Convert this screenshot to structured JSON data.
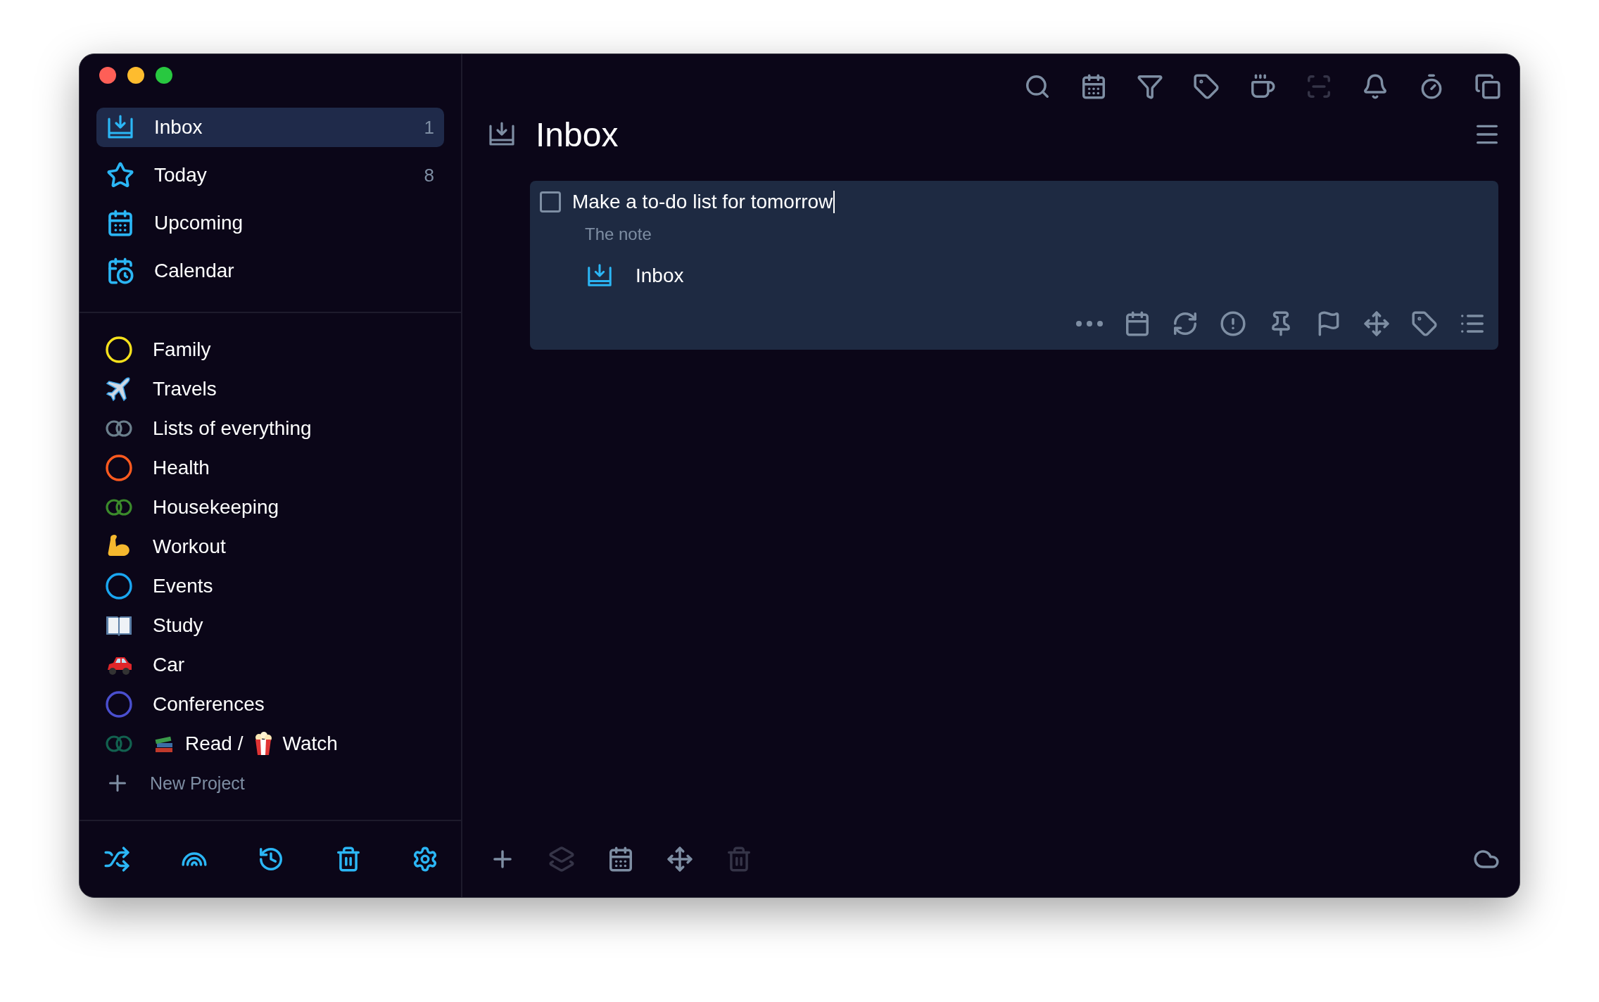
{
  "window": {
    "controls": [
      {
        "color": "#fe5f57"
      },
      {
        "color": "#febc2e"
      },
      {
        "color": "#28c840"
      }
    ]
  },
  "sidebar": {
    "nav": [
      {
        "kind": "inbox",
        "label": "Inbox",
        "count": "1",
        "selected": true
      },
      {
        "kind": "today",
        "label": "Today",
        "count": "8",
        "selected": false
      },
      {
        "kind": "upcoming",
        "label": "Upcoming",
        "selected": false
      },
      {
        "kind": "calendar",
        "label": "Calendar",
        "selected": false
      }
    ],
    "projects": [
      {
        "kind": "ring",
        "color": "#f5e11c",
        "label": "Family"
      },
      {
        "kind": "plane",
        "label": "Travels"
      },
      {
        "kind": "double-ring",
        "color": "#6b7f8c",
        "label": "Lists of everything"
      },
      {
        "kind": "ring",
        "color": "#ff5a1f",
        "label": "Health"
      },
      {
        "kind": "double-ring",
        "color": "#3b8a2b",
        "label": "Housekeeping"
      },
      {
        "kind": "arm",
        "label": "Workout"
      },
      {
        "kind": "ring",
        "color": "#1aa6f0",
        "label": "Events"
      },
      {
        "kind": "book",
        "label": "Study"
      },
      {
        "kind": "car",
        "label": "Car"
      },
      {
        "kind": "ring",
        "color": "#4a4fcf",
        "label": "Conferences"
      },
      {
        "kind": "double-ring",
        "color": "#12614f",
        "segments": [
          {
            "kind": "books"
          },
          {
            "kind": "text",
            "text": "Read /"
          },
          {
            "kind": "popcorn"
          },
          {
            "kind": "text",
            "text": "Watch"
          }
        ]
      }
    ],
    "new_project": "New Project",
    "bottom_tools": [
      {
        "kind": "shuffle"
      },
      {
        "kind": "rainbow"
      },
      {
        "kind": "history"
      },
      {
        "kind": "trash"
      },
      {
        "kind": "settings"
      }
    ]
  },
  "toolbar": [
    {
      "kind": "search",
      "disabled": false
    },
    {
      "kind": "calendar",
      "disabled": false
    },
    {
      "kind": "filter",
      "disabled": false
    },
    {
      "kind": "tag",
      "disabled": false
    },
    {
      "kind": "coffee",
      "disabled": false
    },
    {
      "kind": "focus",
      "disabled": true
    },
    {
      "kind": "bell",
      "disabled": false
    },
    {
      "kind": "timer",
      "disabled": false
    },
    {
      "kind": "copy",
      "disabled": false
    }
  ],
  "main": {
    "title": "Inbox",
    "task": {
      "title": "Make a to-do list for tomorrow",
      "checked": false,
      "editing": true,
      "note_placeholder": "The note",
      "project": "Inbox",
      "actions": [
        {
          "kind": "more"
        },
        {
          "kind": "date"
        },
        {
          "kind": "repeat"
        },
        {
          "kind": "priority"
        },
        {
          "kind": "pin"
        },
        {
          "kind": "flag"
        },
        {
          "kind": "move"
        },
        {
          "kind": "tag"
        },
        {
          "kind": "checklist"
        }
      ]
    },
    "bottom_tools": [
      {
        "kind": "add",
        "disabled": false
      },
      {
        "kind": "layers",
        "disabled": true
      },
      {
        "kind": "calendar",
        "disabled": false
      },
      {
        "kind": "move",
        "disabled": false
      },
      {
        "kind": "trash",
        "disabled": true
      }
    ],
    "sync": {
      "kind": "cloud"
    }
  }
}
